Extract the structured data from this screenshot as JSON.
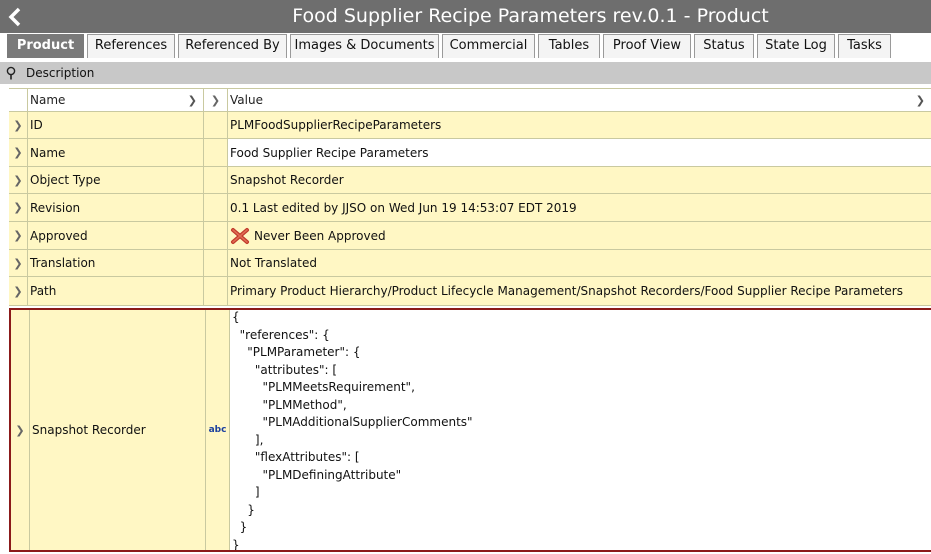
{
  "window": {
    "title": "Food Supplier Recipe Parameters rev.0.1 - Product",
    "back_icon": "chevron-left-icon"
  },
  "tabs": [
    {
      "label": "Product",
      "active": true
    },
    {
      "label": "References",
      "active": false
    },
    {
      "label": "Referenced By",
      "active": false
    },
    {
      "label": "Images & Documents",
      "active": false
    },
    {
      "label": "Commercial",
      "active": false
    },
    {
      "label": "Tables",
      "active": false
    },
    {
      "label": "Proof View",
      "active": false
    },
    {
      "label": "Status",
      "active": false
    },
    {
      "label": "State Log",
      "active": false
    },
    {
      "label": "Tasks",
      "active": false
    }
  ],
  "section": {
    "title": "Description",
    "icon": "pin-icon"
  },
  "grid": {
    "headers": {
      "name": "Name",
      "value": "Value"
    },
    "rows": [
      {
        "name": "ID",
        "value": "PLMFoodSupplierRecipeParameters"
      },
      {
        "name": "Name",
        "value": "Food Supplier Recipe Parameters"
      },
      {
        "name": "Object Type",
        "value": "Snapshot Recorder"
      },
      {
        "name": "Revision",
        "value": "0.1 Last edited by JJSO on Wed Jun 19 14:53:07 EDT 2019"
      },
      {
        "name": "Approved",
        "value": "Never Been Approved",
        "icon": "not-approved-icon"
      },
      {
        "name": "Translation",
        "value": "Not Translated"
      },
      {
        "name": "Path",
        "value": "Primary Product Hierarchy/Product Lifecycle Management/Snapshot Recorders/Food Supplier Recipe Parameters"
      }
    ],
    "snapshot": {
      "name": "Snapshot Recorder",
      "type_badge": "abc",
      "value": "{\n  \"references\": {\n    \"PLMParameter\": {\n      \"attributes\": [\n        \"PLMMeetsRequirement\",\n        \"PLMMethod\",\n        \"PLMAdditionalSupplierComments\"\n      ],\n      \"flexAttributes\": [\n        \"PLMDefiningAttribute\"\n      ]\n    }\n  }\n}"
    }
  },
  "colors": {
    "titlebar": "#6e6e6e",
    "row_yellow": "#fff7c4",
    "selection_border": "#8b1a1a",
    "not_approved": "#c0392b"
  }
}
